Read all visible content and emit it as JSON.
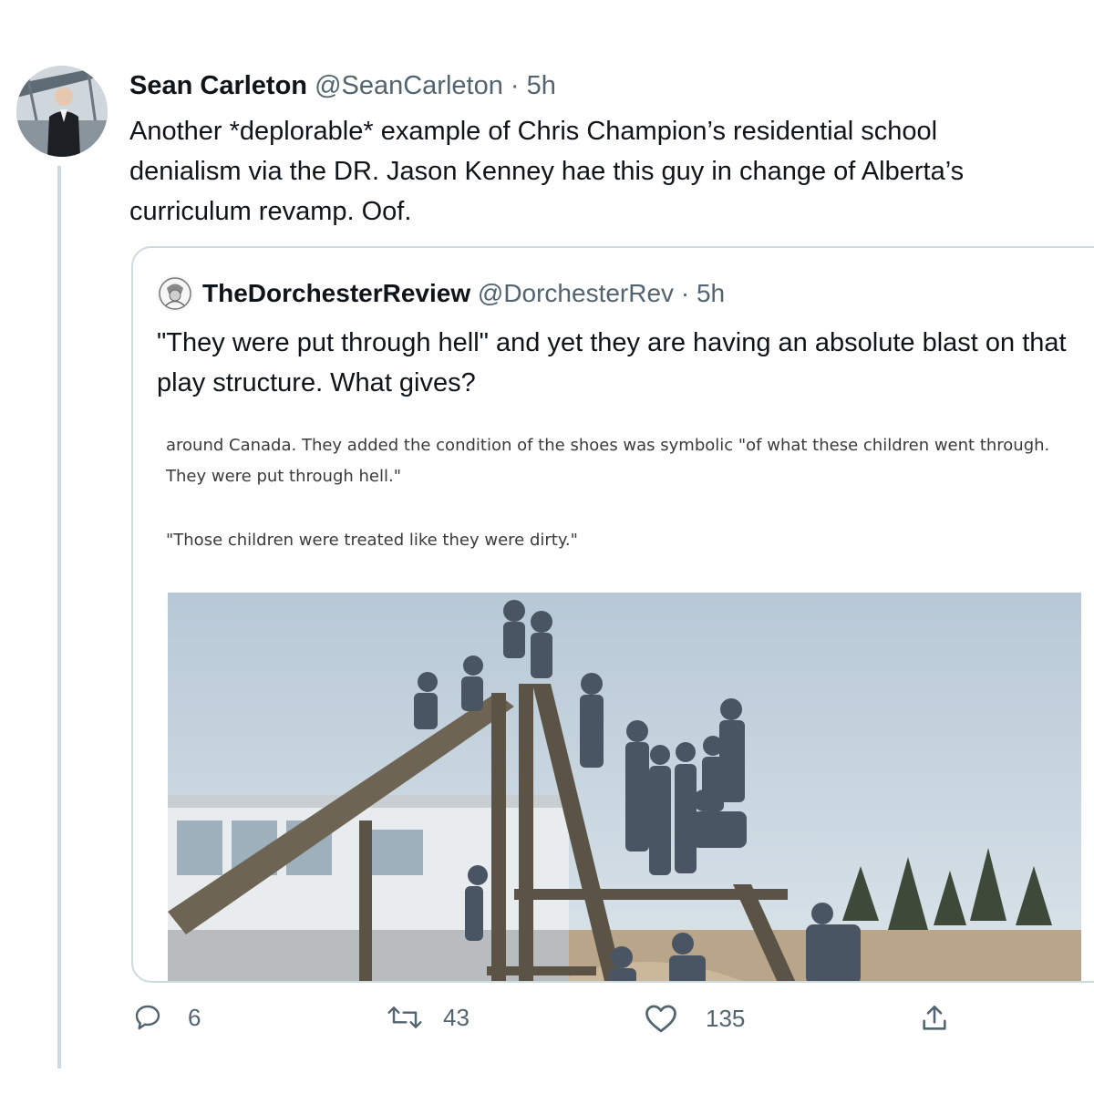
{
  "tweet": {
    "author_name": "Sean Carleton",
    "author_handle": "@SeanCarleton",
    "separator": "·",
    "time": "5h",
    "text": "Another *deplorable* example of Chris Champion’s residential school denialism via the DR. Jason Kenney hae this guy in change of Alberta’s curriculum revamp. Oof."
  },
  "quoted_tweet": {
    "author_name": "TheDorchesterReview",
    "author_handle": "@DorchesterRev",
    "separator": "·",
    "time": "5h",
    "text": "\"They were put through hell\" and yet they are having an absolute blast on that play structure. What gives?",
    "article_excerpt": {
      "paragraph_1": "around Canada. They added the condition of the shoes was symbolic \"of what these children went through. They were put through hell.\"",
      "paragraph_2": "\"Those children were treated like they were dirty.\""
    }
  },
  "actions": {
    "reply": {
      "icon": "reply-icon",
      "count": "6"
    },
    "retweet": {
      "icon": "retweet-icon",
      "count": "43"
    },
    "like": {
      "icon": "heart-icon",
      "count": "135"
    },
    "share": {
      "icon": "share-icon"
    }
  },
  "colors": {
    "text_primary": "#0f1419",
    "text_secondary": "#536471",
    "border": "#cfd9de"
  }
}
